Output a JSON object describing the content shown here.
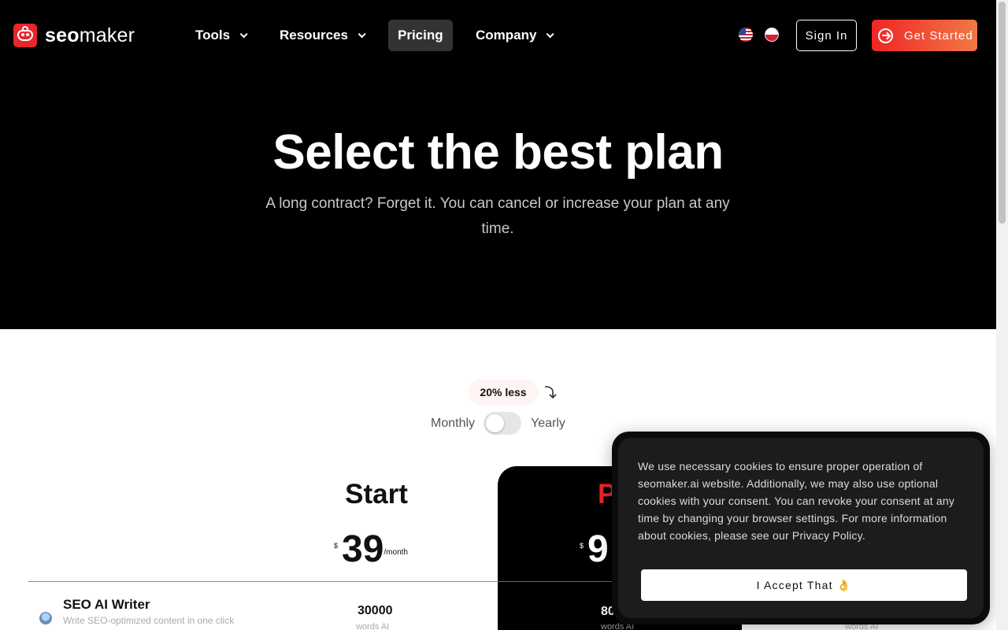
{
  "brand": {
    "name_bold": "seo",
    "name_light": "maker"
  },
  "nav": {
    "items": [
      {
        "label": "Tools",
        "has_dropdown": true
      },
      {
        "label": "Resources",
        "has_dropdown": true
      },
      {
        "label": "Pricing",
        "has_dropdown": false,
        "active": true
      },
      {
        "label": "Company",
        "has_dropdown": true
      }
    ],
    "languages": [
      "en-us",
      "pl"
    ],
    "sign_in": "Sign In",
    "get_started": "Get Started"
  },
  "hero": {
    "title": "Select the best plan",
    "subtitle": "A long contract? Forget it. You can cancel or increase your plan at any time."
  },
  "billing": {
    "discount_badge": "20% less",
    "monthly_label": "Monthly",
    "yearly_label": "Yearly",
    "yearly_enabled": false
  },
  "plans": {
    "start": {
      "name": "Start",
      "currency": "$",
      "price": "39",
      "period": "/month"
    },
    "pro": {
      "name": "P",
      "currency": "$",
      "price": "9"
    }
  },
  "features": [
    {
      "title": "SEO AI Writer",
      "description": "Write SEO-optimized content in one click",
      "start_value": "30000",
      "start_unit": "words AI",
      "pro_value": "80",
      "pro_unit": "words AI",
      "third_unit": "words AI"
    }
  ],
  "cookie": {
    "text_before_link": "We use necessary cookies to ensure proper operation of seomaker.ai website. Additionally, we may also use optional cookies with your consent. You can revoke your consent at any time by changing your browser settings. For more information about cookies, please see our ",
    "link": "Privacy Policy",
    "text_after_link": ".",
    "accept_button": "I Accept That 👌"
  },
  "colors": {
    "brand_red": "#e8262b",
    "cta_gradient_start": "#ef2525",
    "cta_gradient_end": "#f07845",
    "hero_bg": "#000000"
  }
}
